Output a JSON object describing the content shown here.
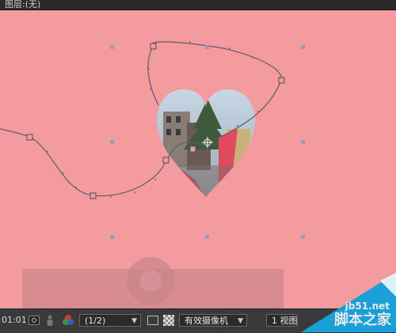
{
  "top_bar": {
    "title": "图层:(无)"
  },
  "bottom_bar": {
    "timecode": "01:01",
    "resolution": "(1/2)",
    "camera": "有效摄像机",
    "view": "1 视图"
  },
  "watermark": {
    "url": "jb51.net",
    "site": "脚本之家"
  },
  "icons": {
    "camera": "camera-icon",
    "person": "person-icon",
    "rgb": "color-channels-icon",
    "region": "region-of-interest-icon",
    "transparency": "transparency-grid-icon"
  },
  "colors": {
    "canvas_bg": "#f49b9e",
    "path_stroke": "#555566",
    "handle": "#9a9ac0"
  }
}
